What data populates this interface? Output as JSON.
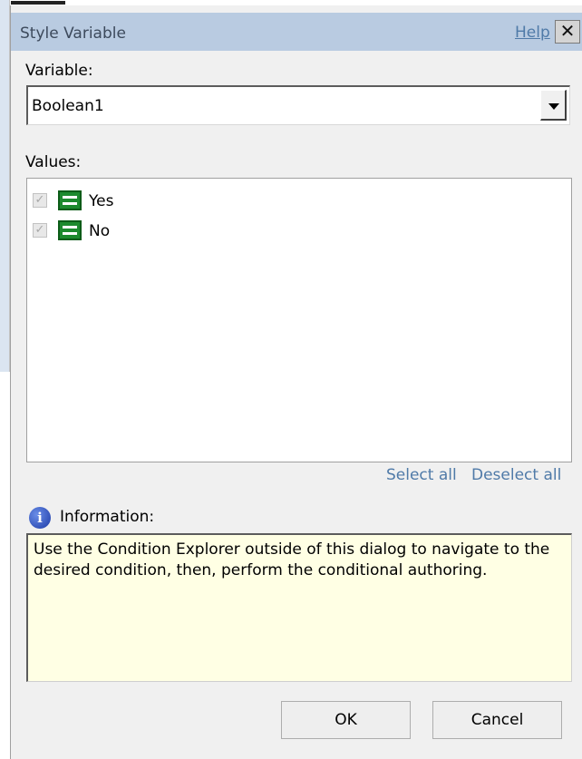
{
  "dialog": {
    "title": "Style Variable",
    "help_label": "Help",
    "close_label": "✕"
  },
  "variable": {
    "label": "Variable:",
    "selected": "Boolean1"
  },
  "values": {
    "label": "Values:",
    "items": [
      {
        "label": "Yes",
        "checked": true,
        "enabled": false,
        "icon": "boolean-value-icon"
      },
      {
        "label": "No",
        "checked": true,
        "enabled": false,
        "icon": "boolean-value-icon"
      }
    ],
    "select_all": "Select all",
    "deselect_all": "Deselect all"
  },
  "information": {
    "label": "Information:",
    "text": "Use the Condition Explorer outside of this dialog to navigate to the desired condition, then, perform the conditional authoring."
  },
  "buttons": {
    "ok": "OK",
    "cancel": "Cancel"
  },
  "colors": {
    "titlebar": "#b9cbe1",
    "link": "#4f7aa8",
    "info_background": "#ffffe4",
    "value_icon": "#1d8a2e"
  }
}
